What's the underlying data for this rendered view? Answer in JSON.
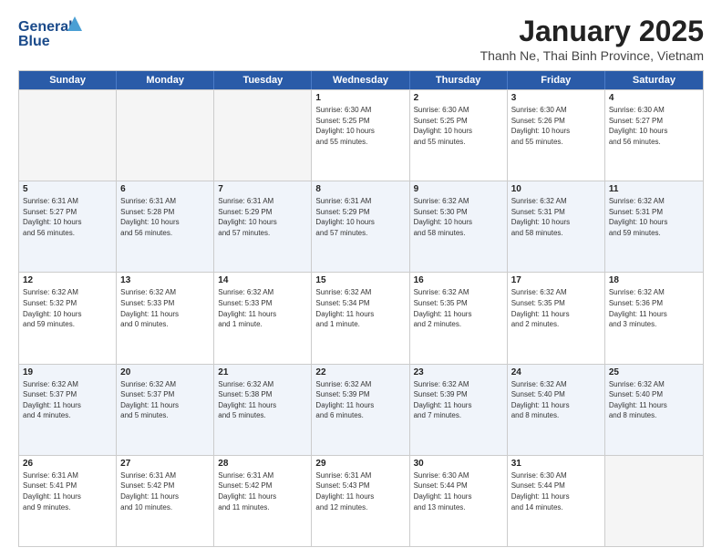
{
  "logo": {
    "line1": "General",
    "line2": "Blue",
    "tagline": ""
  },
  "title": "January 2025",
  "subtitle": "Thanh Ne, Thai Binh Province, Vietnam",
  "days": [
    "Sunday",
    "Monday",
    "Tuesday",
    "Wednesday",
    "Thursday",
    "Friday",
    "Saturday"
  ],
  "rows": [
    [
      {
        "day": "",
        "info": ""
      },
      {
        "day": "",
        "info": ""
      },
      {
        "day": "",
        "info": ""
      },
      {
        "day": "1",
        "info": "Sunrise: 6:30 AM\nSunset: 5:25 PM\nDaylight: 10 hours\nand 55 minutes."
      },
      {
        "day": "2",
        "info": "Sunrise: 6:30 AM\nSunset: 5:25 PM\nDaylight: 10 hours\nand 55 minutes."
      },
      {
        "day": "3",
        "info": "Sunrise: 6:30 AM\nSunset: 5:26 PM\nDaylight: 10 hours\nand 55 minutes."
      },
      {
        "day": "4",
        "info": "Sunrise: 6:30 AM\nSunset: 5:27 PM\nDaylight: 10 hours\nand 56 minutes."
      }
    ],
    [
      {
        "day": "5",
        "info": "Sunrise: 6:31 AM\nSunset: 5:27 PM\nDaylight: 10 hours\nand 56 minutes."
      },
      {
        "day": "6",
        "info": "Sunrise: 6:31 AM\nSunset: 5:28 PM\nDaylight: 10 hours\nand 56 minutes."
      },
      {
        "day": "7",
        "info": "Sunrise: 6:31 AM\nSunset: 5:29 PM\nDaylight: 10 hours\nand 57 minutes."
      },
      {
        "day": "8",
        "info": "Sunrise: 6:31 AM\nSunset: 5:29 PM\nDaylight: 10 hours\nand 57 minutes."
      },
      {
        "day": "9",
        "info": "Sunrise: 6:32 AM\nSunset: 5:30 PM\nDaylight: 10 hours\nand 58 minutes."
      },
      {
        "day": "10",
        "info": "Sunrise: 6:32 AM\nSunset: 5:31 PM\nDaylight: 10 hours\nand 58 minutes."
      },
      {
        "day": "11",
        "info": "Sunrise: 6:32 AM\nSunset: 5:31 PM\nDaylight: 10 hours\nand 59 minutes."
      }
    ],
    [
      {
        "day": "12",
        "info": "Sunrise: 6:32 AM\nSunset: 5:32 PM\nDaylight: 10 hours\nand 59 minutes."
      },
      {
        "day": "13",
        "info": "Sunrise: 6:32 AM\nSunset: 5:33 PM\nDaylight: 11 hours\nand 0 minutes."
      },
      {
        "day": "14",
        "info": "Sunrise: 6:32 AM\nSunset: 5:33 PM\nDaylight: 11 hours\nand 1 minute."
      },
      {
        "day": "15",
        "info": "Sunrise: 6:32 AM\nSunset: 5:34 PM\nDaylight: 11 hours\nand 1 minute."
      },
      {
        "day": "16",
        "info": "Sunrise: 6:32 AM\nSunset: 5:35 PM\nDaylight: 11 hours\nand 2 minutes."
      },
      {
        "day": "17",
        "info": "Sunrise: 6:32 AM\nSunset: 5:35 PM\nDaylight: 11 hours\nand 2 minutes."
      },
      {
        "day": "18",
        "info": "Sunrise: 6:32 AM\nSunset: 5:36 PM\nDaylight: 11 hours\nand 3 minutes."
      }
    ],
    [
      {
        "day": "19",
        "info": "Sunrise: 6:32 AM\nSunset: 5:37 PM\nDaylight: 11 hours\nand 4 minutes."
      },
      {
        "day": "20",
        "info": "Sunrise: 6:32 AM\nSunset: 5:37 PM\nDaylight: 11 hours\nand 5 minutes."
      },
      {
        "day": "21",
        "info": "Sunrise: 6:32 AM\nSunset: 5:38 PM\nDaylight: 11 hours\nand 5 minutes."
      },
      {
        "day": "22",
        "info": "Sunrise: 6:32 AM\nSunset: 5:39 PM\nDaylight: 11 hours\nand 6 minutes."
      },
      {
        "day": "23",
        "info": "Sunrise: 6:32 AM\nSunset: 5:39 PM\nDaylight: 11 hours\nand 7 minutes."
      },
      {
        "day": "24",
        "info": "Sunrise: 6:32 AM\nSunset: 5:40 PM\nDaylight: 11 hours\nand 8 minutes."
      },
      {
        "day": "25",
        "info": "Sunrise: 6:32 AM\nSunset: 5:40 PM\nDaylight: 11 hours\nand 8 minutes."
      }
    ],
    [
      {
        "day": "26",
        "info": "Sunrise: 6:31 AM\nSunset: 5:41 PM\nDaylight: 11 hours\nand 9 minutes."
      },
      {
        "day": "27",
        "info": "Sunrise: 6:31 AM\nSunset: 5:42 PM\nDaylight: 11 hours\nand 10 minutes."
      },
      {
        "day": "28",
        "info": "Sunrise: 6:31 AM\nSunset: 5:42 PM\nDaylight: 11 hours\nand 11 minutes."
      },
      {
        "day": "29",
        "info": "Sunrise: 6:31 AM\nSunset: 5:43 PM\nDaylight: 11 hours\nand 12 minutes."
      },
      {
        "day": "30",
        "info": "Sunrise: 6:30 AM\nSunset: 5:44 PM\nDaylight: 11 hours\nand 13 minutes."
      },
      {
        "day": "31",
        "info": "Sunrise: 6:30 AM\nSunset: 5:44 PM\nDaylight: 11 hours\nand 14 minutes."
      },
      {
        "day": "",
        "info": ""
      }
    ]
  ]
}
